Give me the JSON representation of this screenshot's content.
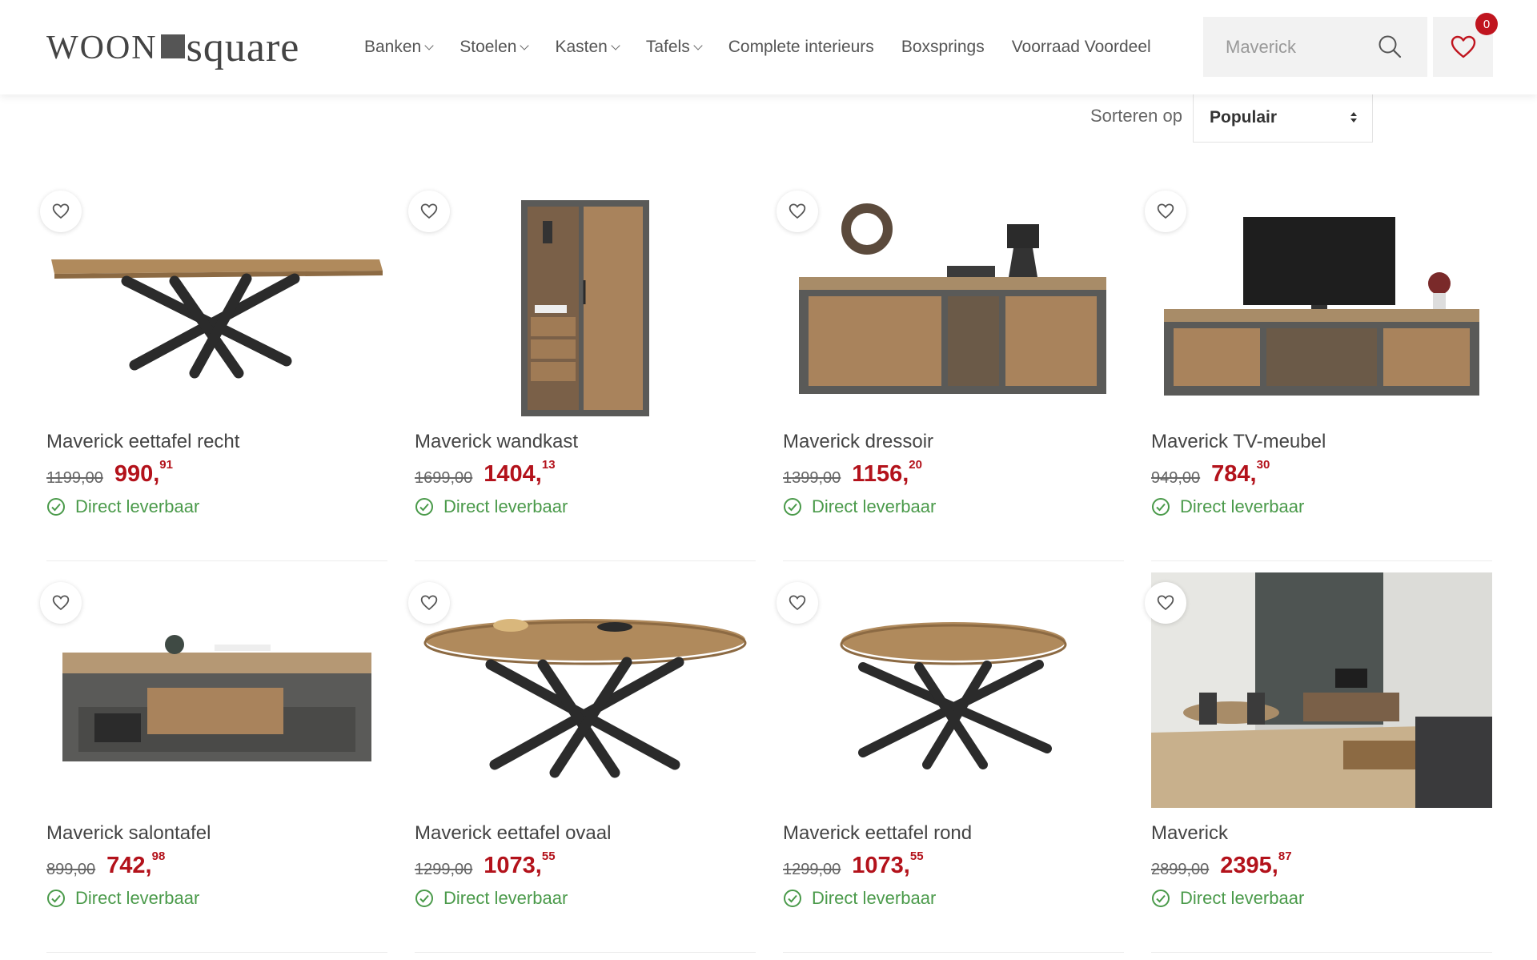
{
  "header": {
    "logo": {
      "part1": "woon",
      "part2": "square"
    },
    "nav": [
      {
        "label": "Banken",
        "has_dropdown": true
      },
      {
        "label": "Stoelen",
        "has_dropdown": true
      },
      {
        "label": "Kasten",
        "has_dropdown": true
      },
      {
        "label": "Tafels",
        "has_dropdown": true
      },
      {
        "label": "Complete interieurs",
        "has_dropdown": false
      },
      {
        "label": "Boxsprings",
        "has_dropdown": false
      },
      {
        "label": "Voorraad Voordeel",
        "has_dropdown": false
      }
    ],
    "search": {
      "value": "Maverick",
      "icon": "search-icon"
    },
    "wishlist": {
      "icon": "heart-icon",
      "count": "0"
    }
  },
  "sort": {
    "label": "Sorteren op",
    "selected": "Populair"
  },
  "colors": {
    "price": "#b3121b",
    "stock": "#4a9a4a",
    "badge": "#c0151f"
  },
  "products": [
    {
      "name": "Maverick eettafel recht",
      "old_price": "1199,00",
      "price_main": "990,",
      "price_cents": "91",
      "stock": "Direct leverbaar",
      "image": "table-rect"
    },
    {
      "name": "Maverick wandkast",
      "old_price": "1699,00",
      "price_main": "1404,",
      "price_cents": "13",
      "stock": "Direct leverbaar",
      "image": "cabinet"
    },
    {
      "name": "Maverick dressoir",
      "old_price": "1399,00",
      "price_main": "1156,",
      "price_cents": "20",
      "stock": "Direct leverbaar",
      "image": "sideboard"
    },
    {
      "name": "Maverick TV-meubel",
      "old_price": "949,00",
      "price_main": "784,",
      "price_cents": "30",
      "stock": "Direct leverbaar",
      "image": "tv-unit"
    },
    {
      "name": "Maverick salontafel",
      "old_price": "899,00",
      "price_main": "742,",
      "price_cents": "98",
      "stock": "Direct leverbaar",
      "image": "coffee-table"
    },
    {
      "name": "Maverick eettafel ovaal",
      "old_price": "1299,00",
      "price_main": "1073,",
      "price_cents": "55",
      "stock": "Direct leverbaar",
      "image": "table-oval"
    },
    {
      "name": "Maverick eettafel rond",
      "old_price": "1299,00",
      "price_main": "1073,",
      "price_cents": "55",
      "stock": "Direct leverbaar",
      "image": "table-round"
    },
    {
      "name": "Maverick",
      "old_price": "2899,00",
      "price_main": "2395,",
      "price_cents": "87",
      "stock": "Direct leverbaar",
      "image": "room"
    }
  ]
}
